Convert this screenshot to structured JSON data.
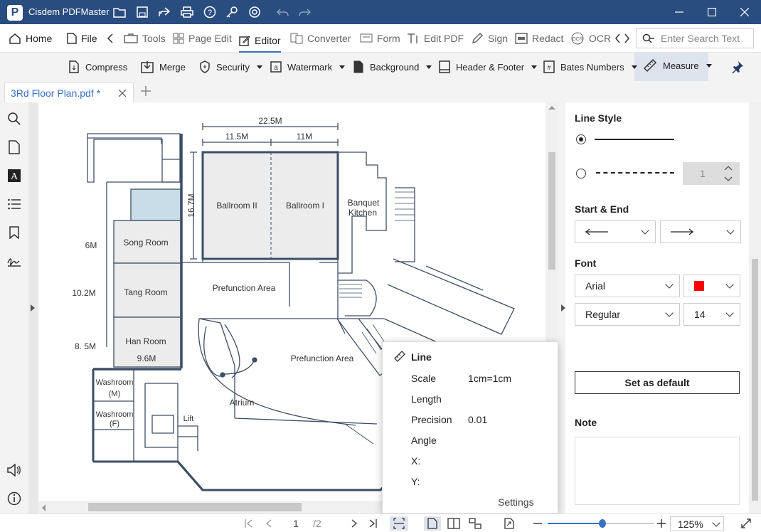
{
  "app": {
    "title": "Cisdem PDFMaster",
    "logo_letter": "P"
  },
  "menubar": {
    "items": [
      "Home",
      "File",
      "Tools",
      "Page Edit",
      "Editor",
      "Converter",
      "Form",
      "Edit PDF",
      "Sign",
      "Redact",
      "OCR"
    ],
    "search_placeholder": "Enter Search Text"
  },
  "toolbar2": {
    "items": [
      "Compress",
      "Merge",
      "Security",
      "Watermark",
      "Background",
      "Header & Footer",
      "Bates Numbers",
      "Measure"
    ]
  },
  "tab": {
    "label": "3Rd Floor Plan.pdf *"
  },
  "floorplan": {
    "dim_total": "22.5M",
    "dim_left": "11.5M",
    "dim_right": "11M",
    "dim_height": "16.7M",
    "side_labels": [
      "6M",
      "10.2M",
      "8. 5M"
    ],
    "dim_room_width": "9.6M",
    "rooms": [
      "Ballroom II",
      "Ballroom I",
      "Banquet",
      "Kitchen",
      "Song Room",
      "Tang Room",
      "Han Room",
      "Prefunction Area",
      "Prefunction Area",
      "Washroom",
      "(M)",
      "Washroom",
      "(F)",
      "Atrium",
      "Lift"
    ]
  },
  "right_panel": {
    "line_style_label": "Line Style",
    "line_width": "1",
    "start_end_label": "Start & End",
    "font_label": "Font",
    "font_family": "Arial",
    "font_style": "Regular",
    "font_size": "14",
    "font_color": "#ff0000",
    "set_default": "Set as default",
    "note_label": "Note"
  },
  "popup": {
    "title": "Line",
    "rows": [
      {
        "label": "Scale",
        "value": "1cm=1cm"
      },
      {
        "label": "Length",
        "value": ""
      },
      {
        "label": "Precision",
        "value": "0.01"
      },
      {
        "label": "Angle",
        "value": ""
      },
      {
        "label": "X:",
        "value": ""
      },
      {
        "label": "Y:",
        "value": ""
      }
    ],
    "settings": "Settings"
  },
  "statusbar": {
    "page": "1",
    "total": "/2",
    "zoom": "125%"
  },
  "colors": {
    "titlebar": "#2a4d7f",
    "accent": "#3b6fc4",
    "wall": "#3d4e66",
    "blue_room": "#c9dde9",
    "room_fill": "#ececec"
  }
}
